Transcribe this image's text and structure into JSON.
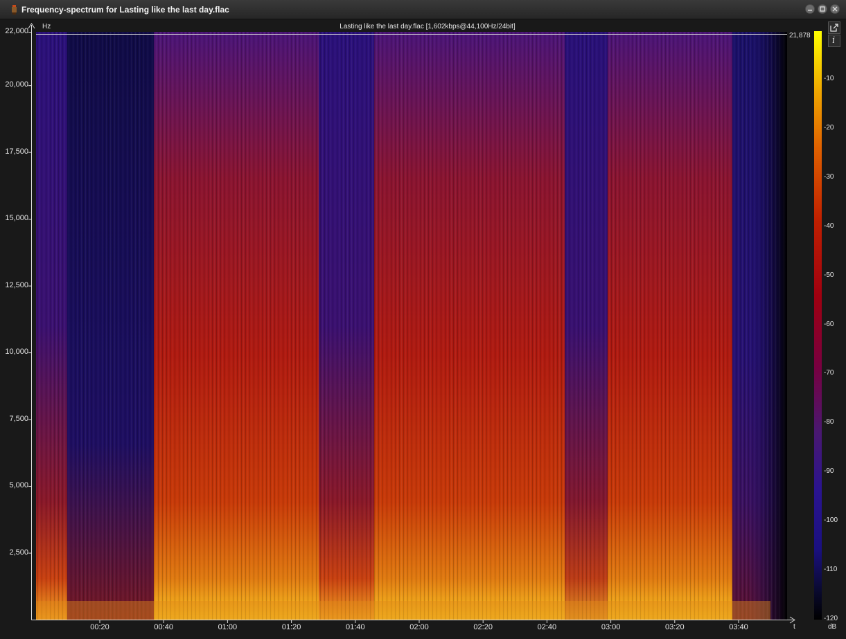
{
  "window": {
    "title": "Frequency-spectrum for Lasting like the last day.flac",
    "icons": {
      "app": "app-icon",
      "minimize": "minimize-icon",
      "maximize": "maximize-icon",
      "close": "close-icon"
    }
  },
  "plot": {
    "file_info": "Lasting like the last day.flac [1,602kbps@44,100Hz/24bit]",
    "y_unit": "Hz",
    "x_unit": "t",
    "max_frequency_label": "21,878",
    "y_ticks": [
      "22,000",
      "20,000",
      "17,500",
      "15,000",
      "12,500",
      "10,000",
      "7,500",
      "5,000",
      "2,500"
    ],
    "x_ticks": [
      "00:20",
      "00:40",
      "01:00",
      "01:20",
      "01:40",
      "02:00",
      "02:20",
      "02:40",
      "03:00",
      "03:20",
      "03:40"
    ],
    "colorbar": {
      "labels": [
        "-10",
        "-20",
        "-30",
        "-40",
        "-50",
        "-60",
        "-70",
        "-80",
        "-90",
        "-100",
        "-110",
        "-120"
      ],
      "unit": "dB",
      "colors": [
        "#ffff00",
        "#f0a800",
        "#e06000",
        "#c02000",
        "#a00010",
        "#780040",
        "#4a1870",
        "#2a1490",
        "#1a1080",
        "#0a0a30",
        "#000000"
      ]
    },
    "tools": {
      "popout": "popout-icon",
      "info": "info-icon",
      "info_glyph": "i"
    }
  }
}
